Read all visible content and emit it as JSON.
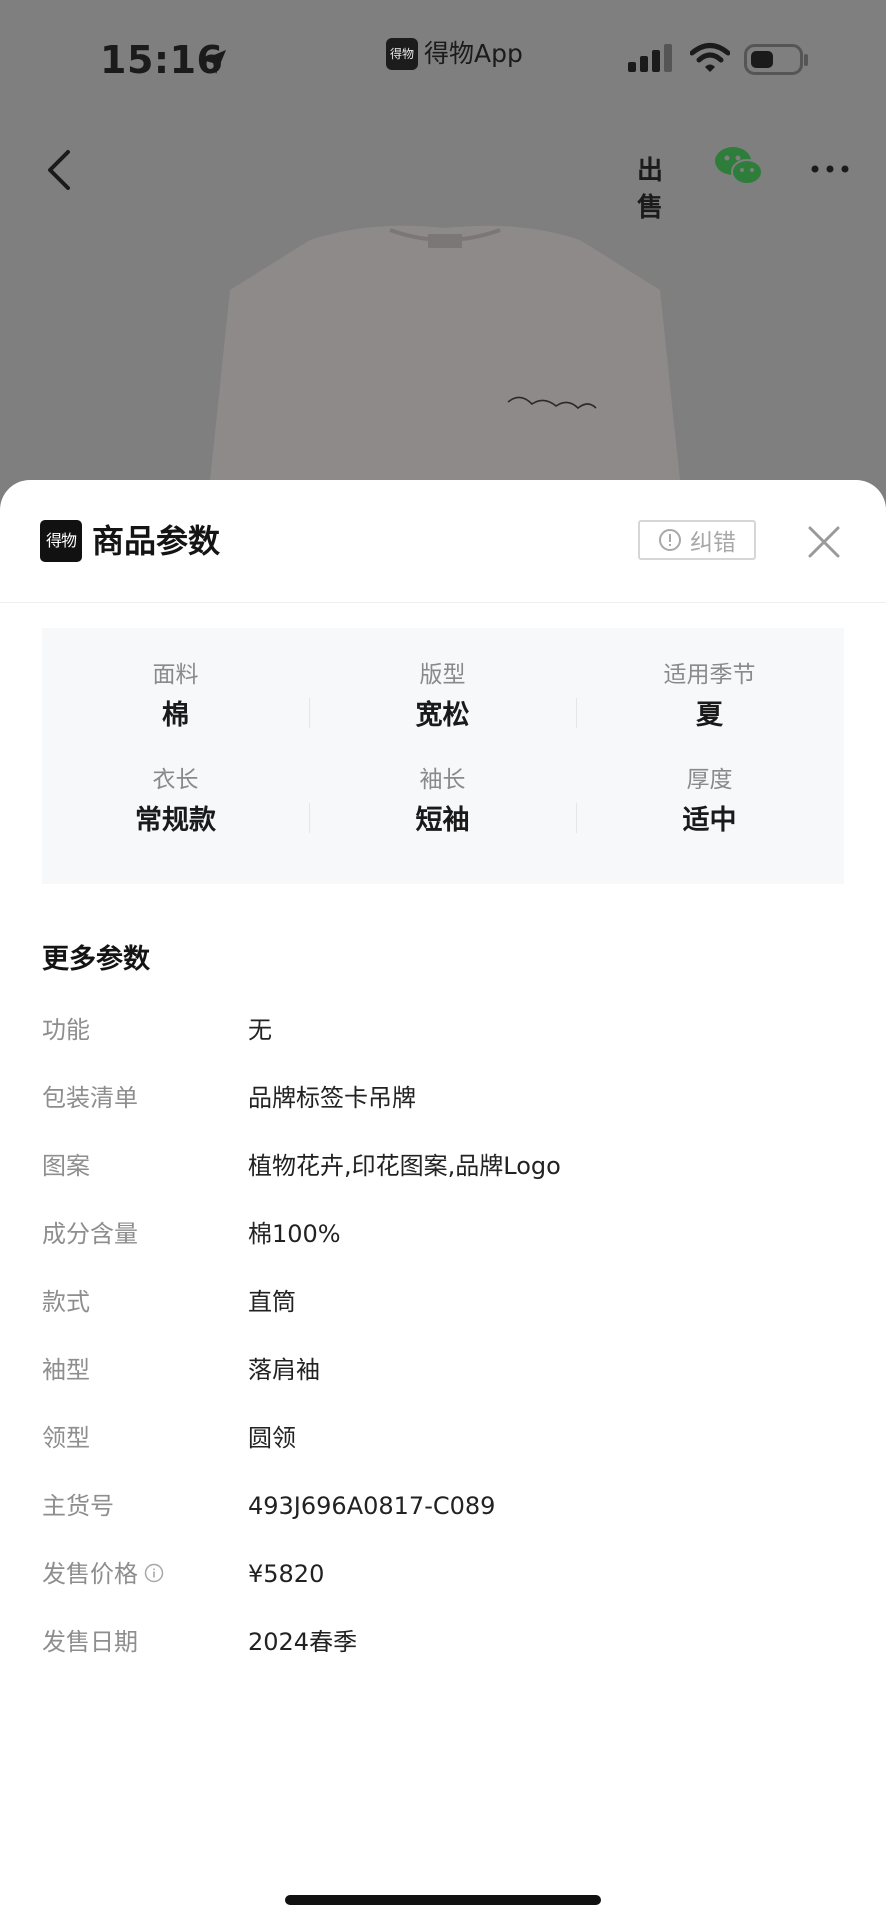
{
  "status_bar": {
    "time": "15:16",
    "app_badge": "得物",
    "app_name": "得物App",
    "icons": [
      "location-arrow-icon",
      "signal-icon",
      "wifi-icon",
      "battery-icon"
    ]
  },
  "nav": {
    "back_icon": "chevron-left-icon",
    "sell_label": "出售",
    "share_icon": "wechat-icon",
    "more_icon": "more-dots-icon"
  },
  "sheet": {
    "logo_text": "得物",
    "title": "商品参数",
    "correct_button": "纠错",
    "close_icon": "close-icon"
  },
  "specs": [
    {
      "label": "面料",
      "value": "棉"
    },
    {
      "label": "版型",
      "value": "宽松"
    },
    {
      "label": "适用季节",
      "value": "夏"
    },
    {
      "label": "衣长",
      "value": "常规款"
    },
    {
      "label": "袖长",
      "value": "短袖"
    },
    {
      "label": "厚度",
      "value": "适中"
    }
  ],
  "more_params": {
    "title": "更多参数",
    "rows": [
      {
        "label": "功能",
        "value": "无"
      },
      {
        "label": "包装清单",
        "value": "品牌标签卡吊牌"
      },
      {
        "label": "图案",
        "value": "植物花卉,印花图案,品牌Logo"
      },
      {
        "label": "成分含量",
        "value": "棉100%"
      },
      {
        "label": "款式",
        "value": "直筒"
      },
      {
        "label": "袖型",
        "value": "落肩袖"
      },
      {
        "label": "领型",
        "value": "圆领"
      },
      {
        "label": "主货号",
        "value": "493J696A0817-C089"
      },
      {
        "label": "发售价格",
        "value": "¥5820"
      },
      {
        "label": "发售日期",
        "value": "2024春季"
      }
    ]
  },
  "colors": {
    "overlay": "#7f7f7f",
    "sheet_bg": "#ffffff",
    "spec_box_bg": "#f7f8fa",
    "label_gray": "#8e8e8e",
    "wechat_green": "#2f7d3a"
  }
}
